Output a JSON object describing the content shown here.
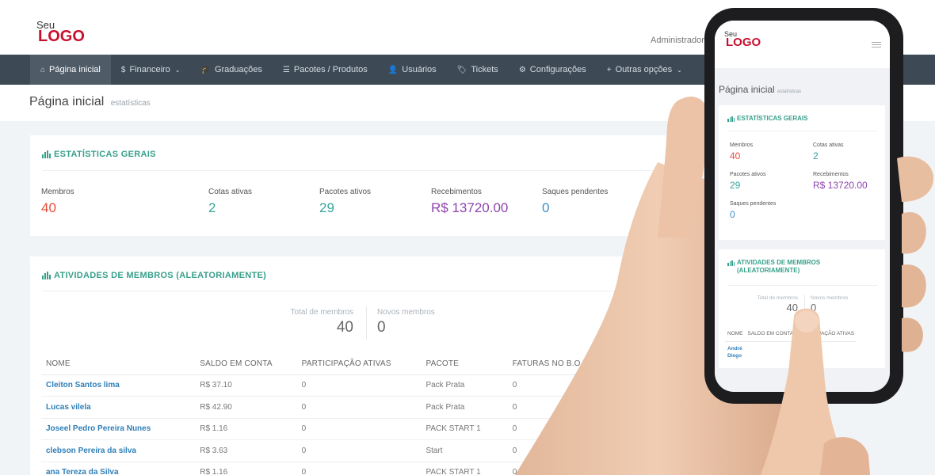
{
  "header": {
    "logo_small": "Seu",
    "logo_big": "LOGO",
    "user": "Administrador"
  },
  "nav": [
    {
      "label": "Página inicial",
      "icon": "home-icon",
      "glyph": "⌂",
      "active": true
    },
    {
      "label": "Financeiro",
      "icon": "dollar-icon",
      "glyph": "$",
      "dropdown": true
    },
    {
      "label": "Graduações",
      "icon": "graduation-cap-icon",
      "glyph": "🎓"
    },
    {
      "label": "Pacotes / Produtos",
      "icon": "list-icon",
      "glyph": "☰"
    },
    {
      "label": "Usuários",
      "icon": "user-icon",
      "glyph": "👤"
    },
    {
      "label": "Tickets",
      "icon": "ticket-icon",
      "glyph": "🏷"
    },
    {
      "label": "Configurações",
      "icon": "gear-icon",
      "glyph": "⚙"
    },
    {
      "label": "Outras opções",
      "icon": "plus-icon",
      "glyph": "+",
      "dropdown": true
    }
  ],
  "page": {
    "title": "Página inicial",
    "subtitle": "estatísticas"
  },
  "stats_card": {
    "title": "ESTATÍSTICAS GERAIS",
    "items": [
      {
        "label": "Membros",
        "value": "40",
        "color": "#e74c3c"
      },
      {
        "label": "Cotas ativas",
        "value": "2",
        "color": "#38a69a"
      },
      {
        "label": "Pacotes ativos",
        "value": "29",
        "color": "#38a69a"
      },
      {
        "label": "Recebimentos",
        "value": "R$ 13720.00",
        "color": "#8e44ad"
      },
      {
        "label": "Saques pendentes",
        "value": "0",
        "color": "#3d8fc7"
      }
    ]
  },
  "activity_card": {
    "title": "ATIVIDADES DE MEMBROS (ALEATORIAMENTE)",
    "totals": [
      {
        "label": "Total de membros",
        "value": "40"
      },
      {
        "label": "Novos membros",
        "value": "0"
      }
    ],
    "columns": [
      "NOME",
      "SALDO EM CONTA",
      "PARTICIPAÇÃO ATIVAS",
      "PACOTE",
      "FATURAS NO B.O"
    ],
    "rows": [
      [
        "Cleiton Santos lima",
        "R$ 37.10",
        "0",
        "Pack Prata",
        "0"
      ],
      [
        "Lucas vilela",
        "R$ 42.90",
        "0",
        "Pack Prata",
        "0"
      ],
      [
        "Joseel Pedro Pereira Nunes",
        "R$ 1.16",
        "0",
        "PACK START 1",
        "0"
      ],
      [
        "clebson Pereira da silva",
        "R$ 3.63",
        "0",
        "Start",
        "0"
      ],
      [
        "ana Tereza da Silva",
        "R$ 1.16",
        "0",
        "PACK START 1",
        "0"
      ]
    ]
  },
  "mobile": {
    "logo_small": "Seu",
    "logo_big": "LOGO",
    "title": "Página inicial",
    "subtitle": "estatísticas",
    "stats_title": "ESTATÍSTICAS GERAIS",
    "activity_title_1": "ATIVIDADES DE MEMBROS",
    "activity_title_2": "(ALEATORIAMENTE)",
    "total_label": "Total de membros",
    "total_value": "40",
    "new_label": "Novos membros",
    "new_value": "0",
    "columns": [
      "NOME",
      "SALDO EM CONTA",
      "PARTICIPAÇÃO ATIVAS"
    ],
    "row_name_1": "André",
    "row_name_2": "Diego"
  },
  "colors": {
    "accent": "#37a08b",
    "nav_bg": "#3d4a56",
    "link": "#2f7fb8"
  }
}
